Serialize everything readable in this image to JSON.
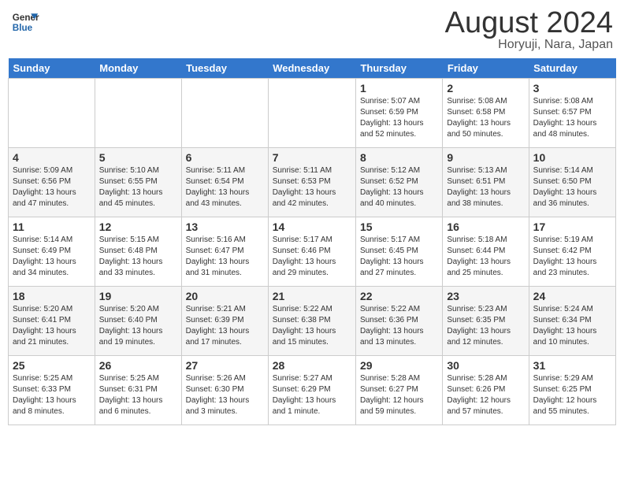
{
  "logo": {
    "line1": "General",
    "line2": "Blue"
  },
  "header": {
    "month": "August 2024",
    "location": "Horyuji, Nara, Japan"
  },
  "weekdays": [
    "Sunday",
    "Monday",
    "Tuesday",
    "Wednesday",
    "Thursday",
    "Friday",
    "Saturday"
  ],
  "weeks": [
    [
      {
        "day": "",
        "info": ""
      },
      {
        "day": "",
        "info": ""
      },
      {
        "day": "",
        "info": ""
      },
      {
        "day": "",
        "info": ""
      },
      {
        "day": "1",
        "info": "Sunrise: 5:07 AM\nSunset: 6:59 PM\nDaylight: 13 hours\nand 52 minutes."
      },
      {
        "day": "2",
        "info": "Sunrise: 5:08 AM\nSunset: 6:58 PM\nDaylight: 13 hours\nand 50 minutes."
      },
      {
        "day": "3",
        "info": "Sunrise: 5:08 AM\nSunset: 6:57 PM\nDaylight: 13 hours\nand 48 minutes."
      }
    ],
    [
      {
        "day": "4",
        "info": "Sunrise: 5:09 AM\nSunset: 6:56 PM\nDaylight: 13 hours\nand 47 minutes."
      },
      {
        "day": "5",
        "info": "Sunrise: 5:10 AM\nSunset: 6:55 PM\nDaylight: 13 hours\nand 45 minutes."
      },
      {
        "day": "6",
        "info": "Sunrise: 5:11 AM\nSunset: 6:54 PM\nDaylight: 13 hours\nand 43 minutes."
      },
      {
        "day": "7",
        "info": "Sunrise: 5:11 AM\nSunset: 6:53 PM\nDaylight: 13 hours\nand 42 minutes."
      },
      {
        "day": "8",
        "info": "Sunrise: 5:12 AM\nSunset: 6:52 PM\nDaylight: 13 hours\nand 40 minutes."
      },
      {
        "day": "9",
        "info": "Sunrise: 5:13 AM\nSunset: 6:51 PM\nDaylight: 13 hours\nand 38 minutes."
      },
      {
        "day": "10",
        "info": "Sunrise: 5:14 AM\nSunset: 6:50 PM\nDaylight: 13 hours\nand 36 minutes."
      }
    ],
    [
      {
        "day": "11",
        "info": "Sunrise: 5:14 AM\nSunset: 6:49 PM\nDaylight: 13 hours\nand 34 minutes."
      },
      {
        "day": "12",
        "info": "Sunrise: 5:15 AM\nSunset: 6:48 PM\nDaylight: 13 hours\nand 33 minutes."
      },
      {
        "day": "13",
        "info": "Sunrise: 5:16 AM\nSunset: 6:47 PM\nDaylight: 13 hours\nand 31 minutes."
      },
      {
        "day": "14",
        "info": "Sunrise: 5:17 AM\nSunset: 6:46 PM\nDaylight: 13 hours\nand 29 minutes."
      },
      {
        "day": "15",
        "info": "Sunrise: 5:17 AM\nSunset: 6:45 PM\nDaylight: 13 hours\nand 27 minutes."
      },
      {
        "day": "16",
        "info": "Sunrise: 5:18 AM\nSunset: 6:44 PM\nDaylight: 13 hours\nand 25 minutes."
      },
      {
        "day": "17",
        "info": "Sunrise: 5:19 AM\nSunset: 6:42 PM\nDaylight: 13 hours\nand 23 minutes."
      }
    ],
    [
      {
        "day": "18",
        "info": "Sunrise: 5:20 AM\nSunset: 6:41 PM\nDaylight: 13 hours\nand 21 minutes."
      },
      {
        "day": "19",
        "info": "Sunrise: 5:20 AM\nSunset: 6:40 PM\nDaylight: 13 hours\nand 19 minutes."
      },
      {
        "day": "20",
        "info": "Sunrise: 5:21 AM\nSunset: 6:39 PM\nDaylight: 13 hours\nand 17 minutes."
      },
      {
        "day": "21",
        "info": "Sunrise: 5:22 AM\nSunset: 6:38 PM\nDaylight: 13 hours\nand 15 minutes."
      },
      {
        "day": "22",
        "info": "Sunrise: 5:22 AM\nSunset: 6:36 PM\nDaylight: 13 hours\nand 13 minutes."
      },
      {
        "day": "23",
        "info": "Sunrise: 5:23 AM\nSunset: 6:35 PM\nDaylight: 13 hours\nand 12 minutes."
      },
      {
        "day": "24",
        "info": "Sunrise: 5:24 AM\nSunset: 6:34 PM\nDaylight: 13 hours\nand 10 minutes."
      }
    ],
    [
      {
        "day": "25",
        "info": "Sunrise: 5:25 AM\nSunset: 6:33 PM\nDaylight: 13 hours\nand 8 minutes."
      },
      {
        "day": "26",
        "info": "Sunrise: 5:25 AM\nSunset: 6:31 PM\nDaylight: 13 hours\nand 6 minutes."
      },
      {
        "day": "27",
        "info": "Sunrise: 5:26 AM\nSunset: 6:30 PM\nDaylight: 13 hours\nand 3 minutes."
      },
      {
        "day": "28",
        "info": "Sunrise: 5:27 AM\nSunset: 6:29 PM\nDaylight: 13 hours\nand 1 minute."
      },
      {
        "day": "29",
        "info": "Sunrise: 5:28 AM\nSunset: 6:27 PM\nDaylight: 12 hours\nand 59 minutes."
      },
      {
        "day": "30",
        "info": "Sunrise: 5:28 AM\nSunset: 6:26 PM\nDaylight: 12 hours\nand 57 minutes."
      },
      {
        "day": "31",
        "info": "Sunrise: 5:29 AM\nSunset: 6:25 PM\nDaylight: 12 hours\nand 55 minutes."
      }
    ]
  ]
}
